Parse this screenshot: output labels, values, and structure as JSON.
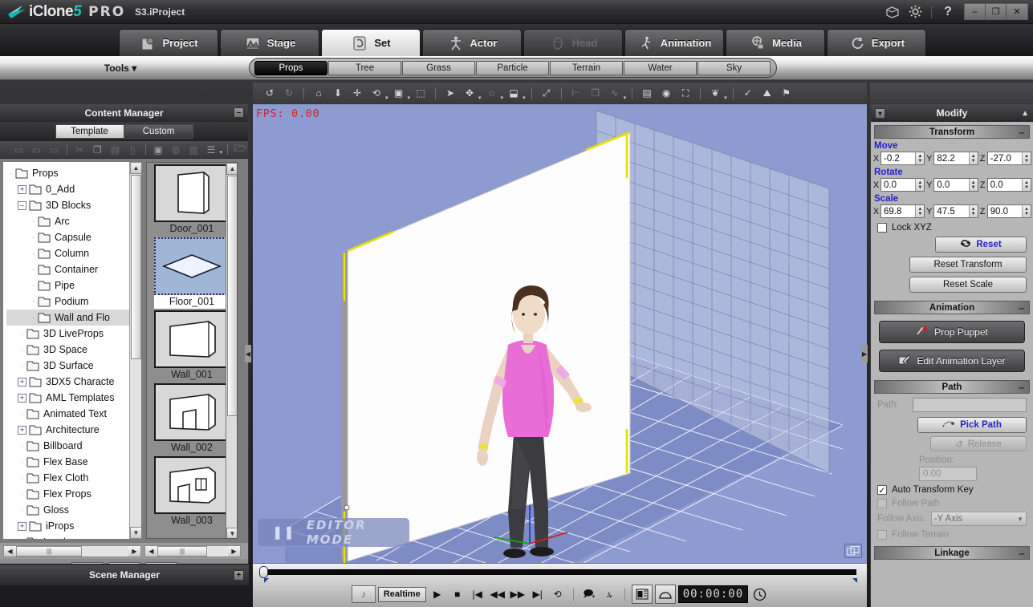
{
  "window": {
    "brand": "iClone",
    "brand_version": "5",
    "edition": "PRO",
    "document": "S3.iProject",
    "minimize": "–",
    "maximize": "❐",
    "close": "✕",
    "help": "?"
  },
  "main_tabs": [
    {
      "label": "Project",
      "icon": "project-icon",
      "state": "normal"
    },
    {
      "label": "Stage",
      "icon": "stage-icon",
      "state": "normal"
    },
    {
      "label": "Set",
      "icon": "set-icon",
      "state": "active"
    },
    {
      "label": "Actor",
      "icon": "actor-icon",
      "state": "normal"
    },
    {
      "label": "Head",
      "icon": "head-icon",
      "state": "disabled"
    },
    {
      "label": "Animation",
      "icon": "animation-icon",
      "state": "normal"
    },
    {
      "label": "Media",
      "icon": "media-icon",
      "state": "normal"
    },
    {
      "label": "Export",
      "icon": "export-icon",
      "state": "normal"
    }
  ],
  "tools": {
    "label": "Tools"
  },
  "sub_tabs": [
    {
      "label": "Props",
      "active": true
    },
    {
      "label": "Tree",
      "active": false
    },
    {
      "label": "Grass",
      "active": false
    },
    {
      "label": "Particle",
      "active": false
    },
    {
      "label": "Terrain",
      "active": false
    },
    {
      "label": "Water",
      "active": false
    },
    {
      "label": "Sky",
      "active": false
    }
  ],
  "content_manager": {
    "title": "Content Manager",
    "collapse": "–",
    "tabs": [
      {
        "label": "Template",
        "active": true
      },
      {
        "label": "Custom",
        "active": false
      }
    ],
    "tree": [
      {
        "label": "Props",
        "depth": 0,
        "toggle": "none",
        "folder": true
      },
      {
        "label": "0_Add",
        "depth": 1,
        "toggle": "plus",
        "folder": true
      },
      {
        "label": "3D Blocks",
        "depth": 1,
        "toggle": "minus",
        "folder": true
      },
      {
        "label": "Arc",
        "depth": 2,
        "toggle": "none",
        "folder": true
      },
      {
        "label": "Capsule",
        "depth": 2,
        "toggle": "none",
        "folder": true
      },
      {
        "label": "Column",
        "depth": 2,
        "toggle": "none",
        "folder": true
      },
      {
        "label": "Container",
        "depth": 2,
        "toggle": "none",
        "folder": true
      },
      {
        "label": "Pipe",
        "depth": 2,
        "toggle": "none",
        "folder": true
      },
      {
        "label": "Podium",
        "depth": 2,
        "toggle": "none",
        "folder": true
      },
      {
        "label": "Wall and Flo",
        "depth": 2,
        "toggle": "none",
        "folder": true,
        "selected": true
      },
      {
        "label": "3D LiveProps",
        "depth": 1,
        "toggle": "none",
        "folder": true
      },
      {
        "label": "3D Space",
        "depth": 1,
        "toggle": "none",
        "folder": true
      },
      {
        "label": "3D Surface",
        "depth": 1,
        "toggle": "none",
        "folder": true
      },
      {
        "label": "3DX5 Characte",
        "depth": 1,
        "toggle": "plus",
        "folder": true
      },
      {
        "label": "AML Templates",
        "depth": 1,
        "toggle": "plus",
        "folder": true
      },
      {
        "label": "Animated Text",
        "depth": 1,
        "toggle": "none",
        "folder": true
      },
      {
        "label": "Architecture",
        "depth": 1,
        "toggle": "plus",
        "folder": true
      },
      {
        "label": "Billboard",
        "depth": 1,
        "toggle": "none",
        "folder": true
      },
      {
        "label": "Flex Base",
        "depth": 1,
        "toggle": "none",
        "folder": true
      },
      {
        "label": "Flex Cloth",
        "depth": 1,
        "toggle": "none",
        "folder": true
      },
      {
        "label": "Flex Props",
        "depth": 1,
        "toggle": "none",
        "folder": true
      },
      {
        "label": "Gloss",
        "depth": 1,
        "toggle": "none",
        "folder": true
      },
      {
        "label": "iProps",
        "depth": 1,
        "toggle": "plus",
        "folder": true
      },
      {
        "label": "Landscape",
        "depth": 1,
        "toggle": "none",
        "folder": true
      }
    ],
    "thumbnails": [
      {
        "label": "Door_001",
        "icon": "door-thumb",
        "selected": false
      },
      {
        "label": "Floor_001",
        "icon": "floor-thumb",
        "selected": true
      },
      {
        "label": "Wall_001",
        "icon": "wall-thumb",
        "selected": false
      },
      {
        "label": "Wall_002",
        "icon": "wall-door-thumb",
        "selected": false
      },
      {
        "label": "Wall_003",
        "icon": "wall-window-thumb",
        "selected": false
      }
    ],
    "nav_buttons": [
      {
        "name": "up-button",
        "glyph": "▲",
        "dim": true
      },
      {
        "name": "add-button",
        "glyph": "✚",
        "dim": false
      },
      {
        "name": "apply-button",
        "glyph": "➜",
        "dim": false
      }
    ]
  },
  "scene_manager": {
    "title": "Scene Manager",
    "expand": "+"
  },
  "viewport": {
    "fps": "FPS: 0.00",
    "editor_mode": "EDITOR MODE",
    "pause_glyph": "❚❚"
  },
  "viewport_toolbar": [
    {
      "name": "undo-icon",
      "glyph": "↺",
      "dim": false
    },
    {
      "name": "redo-icon",
      "glyph": "↻",
      "dim": true
    },
    {
      "name": "home-icon",
      "glyph": "⌂",
      "dim": false
    },
    {
      "name": "drop-to-floor-icon",
      "glyph": "⬇",
      "dim": false
    },
    {
      "name": "move-icon",
      "glyph": "✛",
      "dim": false
    },
    {
      "name": "rotate-icon",
      "glyph": "⟲",
      "dim": false,
      "caret": true
    },
    {
      "name": "scale-icon",
      "glyph": "▣",
      "dim": false,
      "caret": true
    },
    {
      "name": "select-bounds-icon",
      "glyph": "⬚",
      "dim": false
    },
    {
      "name": "pick-icon",
      "glyph": "➤",
      "dim": false
    },
    {
      "name": "camera-move-icon",
      "glyph": "✥",
      "dim": false,
      "caret": true
    },
    {
      "name": "orbit-icon",
      "glyph": "◌",
      "dim": false,
      "caret": true
    },
    {
      "name": "zoom-region-icon",
      "glyph": "⬓",
      "dim": false,
      "caret": true
    },
    {
      "name": "fit-view-icon",
      "glyph": "⤢",
      "dim": false
    },
    {
      "name": "align-icon",
      "glyph": "⊢",
      "dim": true
    },
    {
      "name": "duplicate-icon",
      "glyph": "❐",
      "dim": true
    },
    {
      "name": "curve-icon",
      "glyph": "∿",
      "dim": true,
      "caret": true
    },
    {
      "name": "preview-window-icon",
      "glyph": "▤",
      "dim": false
    },
    {
      "name": "render-icon",
      "glyph": "◉",
      "dim": false
    },
    {
      "name": "full-screen-icon",
      "glyph": "⛶",
      "dim": false
    },
    {
      "name": "leaf-icon",
      "glyph": "❦",
      "dim": false,
      "caret": true
    },
    {
      "name": "key-icon",
      "glyph": "✓",
      "dim": false
    },
    {
      "name": "terrain-icon",
      "glyph": "⛰",
      "dim": false
    },
    {
      "name": "flag-icon",
      "glyph": "⚑",
      "dim": false
    }
  ],
  "cm_toolbar": [
    {
      "name": "new-folder-icon",
      "glyph": "▭",
      "dim": true
    },
    {
      "name": "open-folder-icon",
      "glyph": "▭",
      "dim": true
    },
    {
      "name": "folder-view-icon",
      "glyph": "▭",
      "dim": true
    },
    {
      "name": "cut-icon",
      "glyph": "✂",
      "dim": true
    },
    {
      "name": "copy-icon",
      "glyph": "❐",
      "dim": false
    },
    {
      "name": "paste-icon",
      "glyph": "▤",
      "dim": true
    },
    {
      "name": "delete-icon",
      "glyph": "▯",
      "dim": true
    },
    {
      "name": "save-icon",
      "glyph": "▣",
      "dim": false
    },
    {
      "name": "capture-icon",
      "glyph": "◍",
      "dim": true
    },
    {
      "name": "thumbnail-icon",
      "glyph": "▥",
      "dim": true
    },
    {
      "name": "list-view-icon",
      "glyph": "☰",
      "dim": false,
      "caret": true
    },
    {
      "name": "open-external-icon",
      "glyph": "🗁",
      "dim": false
    }
  ],
  "modify": {
    "title": "Modify",
    "left_btn": "▾",
    "right_btn": "▲",
    "transform": {
      "section": "Transform",
      "minus": "–",
      "move": {
        "label": "Move",
        "x": "-0.2",
        "y": "82.2",
        "z": "-27.0"
      },
      "rotate": {
        "label": "Rotate",
        "x": "0.0",
        "y": "0.0",
        "z": "0.0"
      },
      "scale": {
        "label": "Scale",
        "x": "69.8",
        "y": "47.5",
        "z": "90.0"
      },
      "lock_xyz": "Lock XYZ",
      "lock_checked": false,
      "reset": "Reset",
      "reset_transform": "Reset Transform",
      "reset_scale": "Reset Scale"
    },
    "animation": {
      "section": "Animation",
      "minus": "–",
      "prop_puppet": "Prop Puppet",
      "edit_animation_layer": "Edit Animation Layer"
    },
    "path": {
      "section": "Path",
      "minus": "–",
      "path_label": "Path:",
      "path_value": "",
      "pick_path": "Pick Path",
      "release": "Release",
      "position_label": "Position:",
      "position_value": "0.00",
      "auto_transform_key": "Auto Transform Key",
      "auto_transform_checked": true,
      "follow_path": "Follow Path",
      "follow_path_checked": false,
      "follow_axis_label": "Follow Axis:",
      "follow_axis_value": "-Y Axis",
      "follow_terrain": "Follow Terrain",
      "follow_terrain_checked": false
    },
    "linkage": {
      "section": "Linkage",
      "minus": "–"
    }
  },
  "transport": {
    "preview_label": "Realtime",
    "timecode": "00:00:00",
    "buttons": [
      {
        "name": "mute-button",
        "glyph": "♪",
        "dim": true
      },
      {
        "name": "play-button",
        "glyph": "▶",
        "dim": false
      },
      {
        "name": "stop-button",
        "glyph": "■",
        "dim": false
      },
      {
        "name": "first-frame-button",
        "glyph": "|◀",
        "dim": false
      },
      {
        "name": "prev-frame-button",
        "glyph": "◀◀",
        "dim": false
      },
      {
        "name": "next-frame-button",
        "glyph": "▶▶",
        "dim": false
      },
      {
        "name": "last-frame-button",
        "glyph": "▶|",
        "dim": false
      },
      {
        "name": "loop-button",
        "glyph": "⟲",
        "dim": false
      }
    ]
  },
  "colors": {
    "viewport_bg": "#8d9bd0",
    "accent_blue": "#2222c8",
    "fps_red": "#d82020",
    "brand_teal": "#19c3c3",
    "selection_yellow": "#e8e000"
  }
}
